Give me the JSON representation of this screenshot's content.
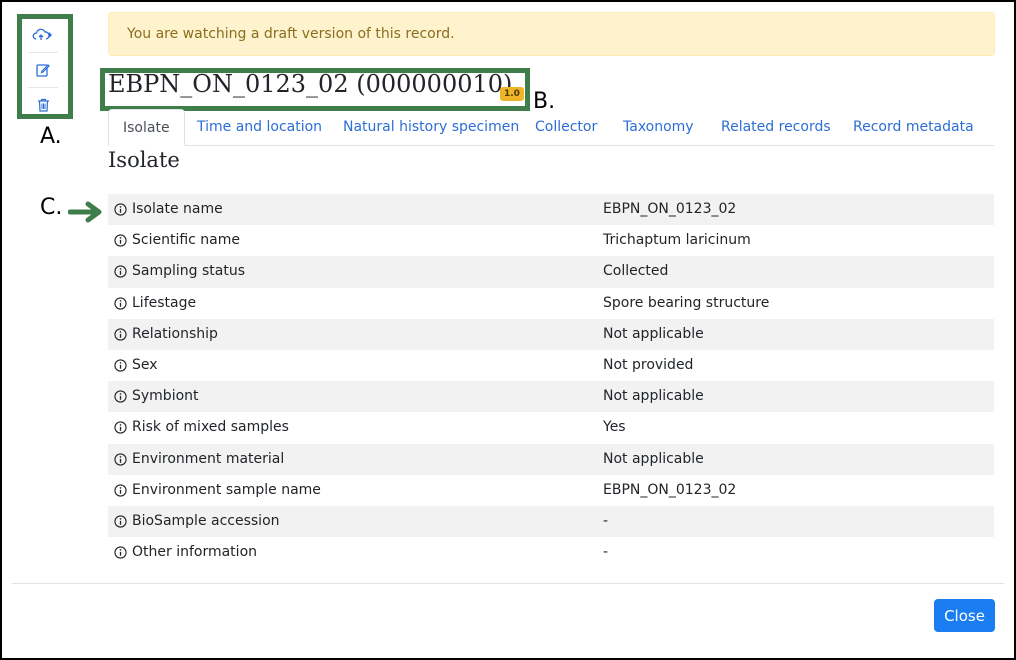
{
  "alert": {
    "text": "You are watching a draft version of this record."
  },
  "record": {
    "title": "EBPN_ON_0123_02 (000000010)",
    "version": "1.0"
  },
  "tabs": [
    {
      "label": "Isolate",
      "active": true
    },
    {
      "label": "Time and location"
    },
    {
      "label": "Natural history specimen"
    },
    {
      "label": "Collector"
    },
    {
      "label": "Taxonomy"
    },
    {
      "label": "Related records"
    },
    {
      "label": "Record metadata"
    }
  ],
  "section": {
    "title": "Isolate"
  },
  "rows": [
    {
      "label": "Isolate name",
      "value": "EBPN_ON_0123_02"
    },
    {
      "label": "Scientific name",
      "value": "Trichaptum laricinum"
    },
    {
      "label": "Sampling status",
      "value": "Collected"
    },
    {
      "label": "Lifestage",
      "value": "Spore bearing structure"
    },
    {
      "label": "Relationship",
      "value": "Not applicable"
    },
    {
      "label": "Sex",
      "value": "Not provided"
    },
    {
      "label": "Symbiont",
      "value": "Not applicable"
    },
    {
      "label": "Risk of mixed samples",
      "value": "Yes"
    },
    {
      "label": "Environment material",
      "value": "Not applicable"
    },
    {
      "label": "Environment sample name",
      "value": "EBPN_ON_0123_02"
    },
    {
      "label": "BioSample accession",
      "value": "-"
    },
    {
      "label": "Other information",
      "value": "-"
    }
  ],
  "footer": {
    "close_label": "Close"
  },
  "annotations": {
    "a": "A.",
    "b": "B.",
    "c": "C."
  },
  "toolbar": {
    "icons": [
      "cloud-upload-icon",
      "edit-icon",
      "trash-icon"
    ]
  },
  "colors": {
    "annotation": "#3f7d4a",
    "link": "#2d6ed6",
    "primary": "#1a7df2",
    "alert_bg": "#fff3cd",
    "badge": "#f0b429"
  }
}
